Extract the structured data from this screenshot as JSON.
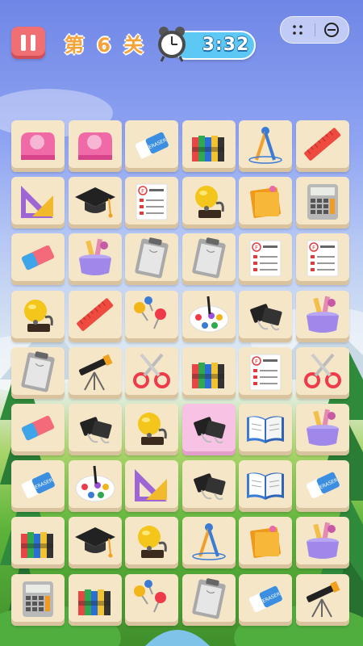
{
  "hud": {
    "level_label": "第 6 关",
    "timer": "3:32"
  },
  "colors": {
    "pause": "#ef6f73",
    "level_text": "#f6a23a",
    "timer_pill": "#5ec8f4",
    "tile": "#f6e6c8",
    "tile_selected": "#f7c2e3"
  },
  "board": {
    "columns": 6,
    "rows": 9,
    "selected_cell": [
      5,
      3
    ],
    "grid": [
      [
        "tape-dispenser",
        "tape-dispenser",
        "eraser",
        "crayons",
        "compass",
        "ruler"
      ],
      [
        "triangle-ruler",
        "graduation-cap",
        "test-paper",
        "school-bell",
        "sticky-notes",
        "calculator"
      ],
      [
        "eraser-pink",
        "pencil-cup",
        "clipboard",
        "clipboard",
        "test-paper",
        "test-paper"
      ],
      [
        "school-bell",
        "ruler",
        "push-pins",
        "paint-palette",
        "binder-clips",
        "pencil-cup"
      ],
      [
        "clipboard",
        "telescope",
        "scissors",
        "crayons",
        "test-paper",
        "scissors"
      ],
      [
        "eraser-pink",
        "binder-clips",
        "school-bell",
        "binder-clips",
        "open-book",
        "pencil-cup"
      ],
      [
        "eraser",
        "paint-palette",
        "triangle-ruler",
        "binder-clips",
        "open-book",
        "eraser"
      ],
      [
        "crayons",
        "graduation-cap",
        "school-bell",
        "compass",
        "sticky-notes",
        "pencil-cup"
      ],
      [
        "calculator",
        "crayons",
        "push-pins",
        "clipboard",
        "eraser",
        "telescope"
      ]
    ]
  }
}
